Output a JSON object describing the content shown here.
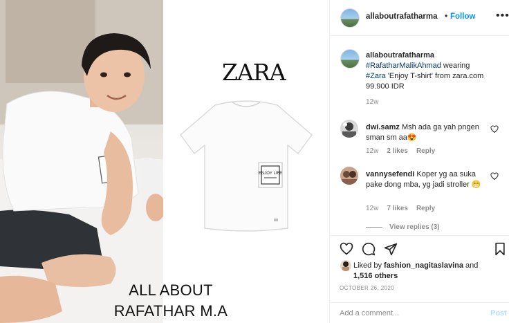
{
  "media": {
    "brand": "ZARA",
    "caption_line1": "ALL ABOUT",
    "caption_line2": "RAFATHAR M.A",
    "tshirt_label": "ENJOY LIFE"
  },
  "header": {
    "username": "allaboutrafatharma",
    "dot": "•",
    "follow_label": "Follow",
    "more_label": "•••"
  },
  "caption": {
    "username": "allaboutrafatharma",
    "tag1": "#RafatharMalikAhmad",
    "text1": " wearing",
    "tag2": "#Zara",
    "text2": " 'Enjoy T-shirt' from zara.com",
    "text3": "99.900 IDR",
    "time": "12w"
  },
  "comments": [
    {
      "username": "dwi.samz",
      "text": " Msh ada ga yah pngen sman sm aa😍",
      "time": "12w",
      "likes": "2 likes",
      "reply": "Reply"
    },
    {
      "username": "vannysefendi",
      "text": " Koper yg aa suka pake dong mba, yg jadi stroller 😁",
      "time": "12w",
      "likes": "7 likes",
      "reply": "Reply",
      "view_replies": "View replies (3)"
    }
  ],
  "likes": {
    "prefix": "Liked by ",
    "user": "fashion_nagitaslavina",
    "middle": " and",
    "count": "1,516 others"
  },
  "date": "OCTOBER 26, 2020",
  "add_comment": {
    "placeholder": "Add a comment...",
    "post_label": "Post"
  },
  "colors": {
    "link_blue": "#0095f6",
    "tag_blue": "#00376b",
    "muted": "#8e8e8e",
    "post_disabled": "#b2dffc"
  },
  "icons": {
    "heart": "heart-icon",
    "comment": "comment-icon",
    "share": "share-icon",
    "save": "bookmark-icon",
    "more": "more-options-icon"
  }
}
